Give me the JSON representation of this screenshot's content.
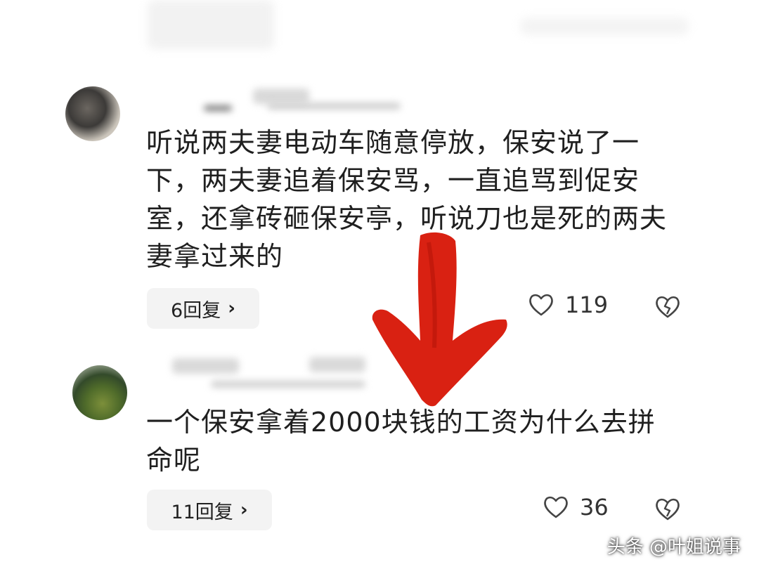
{
  "comments": [
    {
      "text": "听说两夫妻电动车随意停放，保安说了一下，两夫妻追着保安骂，一直追骂到促安室，还拿砖砸保安亭，听说刀也是死的两夫妻拿过来的",
      "reply_label": "6回复",
      "likes": "119"
    },
    {
      "text": "一个保安拿着2000块钱的工资为什么去拼命呢",
      "reply_label": "11回复",
      "likes": "36"
    }
  ],
  "icons": {
    "like": "heart-outline-icon",
    "dislike": "broken-heart-icon",
    "reply_chevron": "chevron-right-icon",
    "annotation": "red-arrow-down"
  },
  "colors": {
    "arrow": "#d81a0a",
    "reply_bg": "#f3f3f3",
    "text": "#1f1f1f"
  },
  "watermark": "头条 @叶姐说事"
}
